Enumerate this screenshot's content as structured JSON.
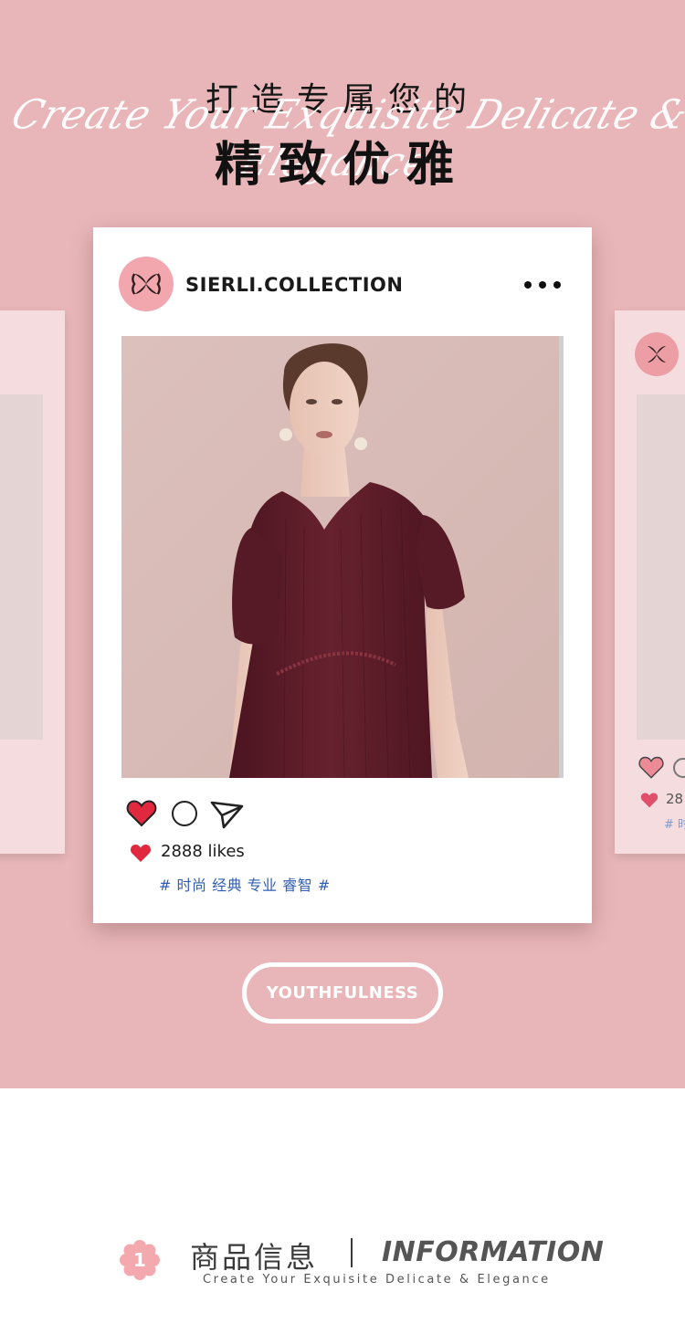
{
  "header": {
    "line1": "打造专属您的",
    "script": "Create Your Exquisite Delicate & Elegance",
    "line2": "精致优雅"
  },
  "post": {
    "username": "SIERLI.COLLECTION",
    "likes": "2888 likes",
    "tags": "# 时尚 经典 专业 睿智 #",
    "more_icon": "more-dots-icon",
    "heart_color": "#e0283e"
  },
  "side_card_right": {
    "likes_partial": "28",
    "tags_partial": "# 时"
  },
  "youth_button": {
    "label": "YOUTHFULNESS"
  },
  "info_section": {
    "number": "1",
    "title_cn": "商品信息",
    "title_en": "INFORMATION",
    "subtitle": "Create Your Exquisite Delicate & Elegance"
  },
  "colors": {
    "background_pink": "#e8b6b8",
    "card_white": "#ffffff",
    "tag_blue": "#2f5fb3",
    "dress_burgundy": "#5b1a25",
    "avatar_pink": "#f2a6ad"
  }
}
